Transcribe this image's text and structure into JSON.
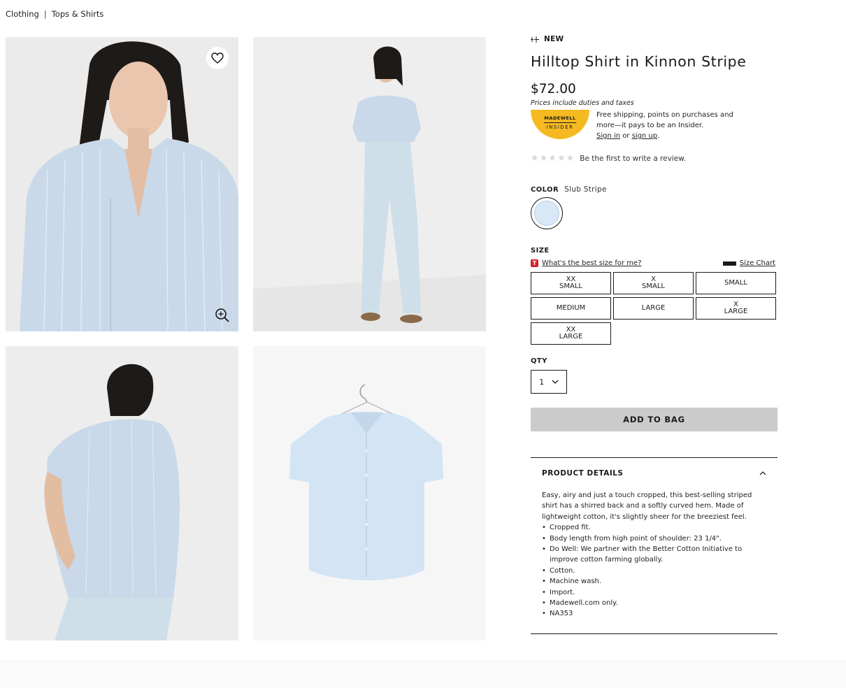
{
  "breadcrumb": {
    "items": [
      "Clothing",
      "Tops & Shirts"
    ],
    "separator": "|"
  },
  "gallery": {
    "images": [
      {
        "alt": "Model front view"
      },
      {
        "alt": "Model full length"
      },
      {
        "alt": "Model back view"
      },
      {
        "alt": "Shirt on hanger"
      }
    ],
    "shirt_color": "#c9d9ea"
  },
  "product": {
    "badge": "NEW",
    "title": "Hilltop Shirt in Kinnon Stripe",
    "price": "$72.00",
    "price_note": "Prices include duties and taxes"
  },
  "insider": {
    "badge_line1": "MADEWELL",
    "badge_line2": "INSIDER",
    "text": "Free shipping, points on purchases and more—it pays to be an Insider.",
    "sign_in": "Sign in",
    "or": " or ",
    "sign_up": "sign up",
    "period": "."
  },
  "reviews": {
    "text": "Be the first to write a review."
  },
  "color": {
    "label": "COLOR",
    "name": "Slub Stripe",
    "swatch_hex": "#d8e8f6"
  },
  "size": {
    "label": "SIZE",
    "fit_help": "What's the best size for me?",
    "fit_badge": "T",
    "size_chart": "Size Chart",
    "options": [
      "XX\nSMALL",
      "X\nSMALL",
      "SMALL",
      "MEDIUM",
      "LARGE",
      "X\nLARGE",
      "XX\nLARGE"
    ]
  },
  "qty": {
    "label": "QTY",
    "value": "1"
  },
  "add_to_bag": "ADD TO BAG",
  "details": {
    "title": "PRODUCT DETAILS",
    "description": "Easy, airy and just a touch cropped, this best-selling striped shirt has a shirred back and a softly curved hem. Made of lightweight cotton, it's slightly sheer for the breeziest feel.",
    "bullets": [
      "Cropped fit.",
      "Body length from high point of shoulder: 23 1/4\".",
      "Do Well: We partner with the Better Cotton Initiative to improve cotton farming globally.",
      "Cotton.",
      "Machine wash.",
      "Import.",
      "Madewell.com only.",
      "NA353"
    ]
  }
}
